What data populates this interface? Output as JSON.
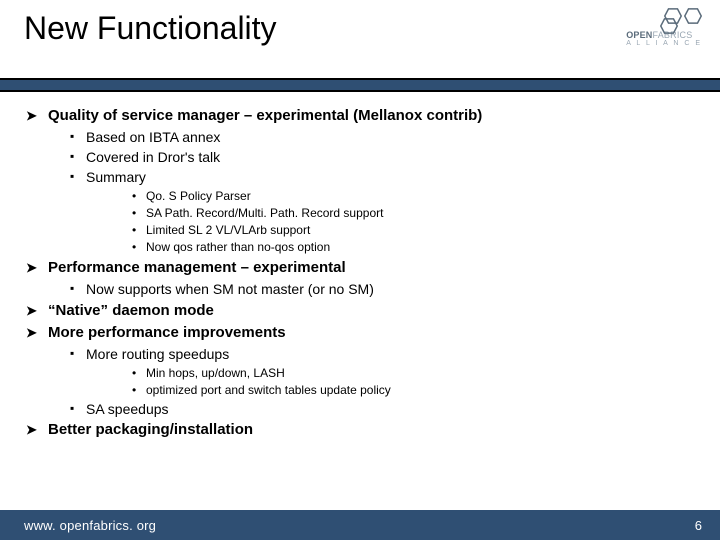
{
  "header": {
    "title": "New Functionality",
    "logo_text_bold": "OPEN",
    "logo_text_light": "FABRICS",
    "logo_sub": "A L L I A N C E"
  },
  "bullets": {
    "b1": "Quality of service manager – experimental (Mellanox contrib)",
    "b1a": "Based on IBTA annex",
    "b1b": "Covered in Dror's talk",
    "b1c": "Summary",
    "b1c1": "Qo. S Policy Parser",
    "b1c2": "SA Path. Record/Multi. Path. Record support",
    "b1c3": "Limited SL 2 VL/VLArb support",
    "b1c4": "Now qos rather than no-qos option",
    "b2": "Performance management – experimental",
    "b2a": "Now supports when SM not master (or no SM)",
    "b3": "“Native” daemon mode",
    "b4": "More performance improvements",
    "b4a": "More routing speedups",
    "b4a1": "Min hops, up/down, LASH",
    "b4a2": "optimized port and switch tables update policy",
    "b4b": "SA speedups",
    "b5": "Better packaging/installation"
  },
  "footer": {
    "url": "www. openfabrics. org",
    "page": "6"
  }
}
